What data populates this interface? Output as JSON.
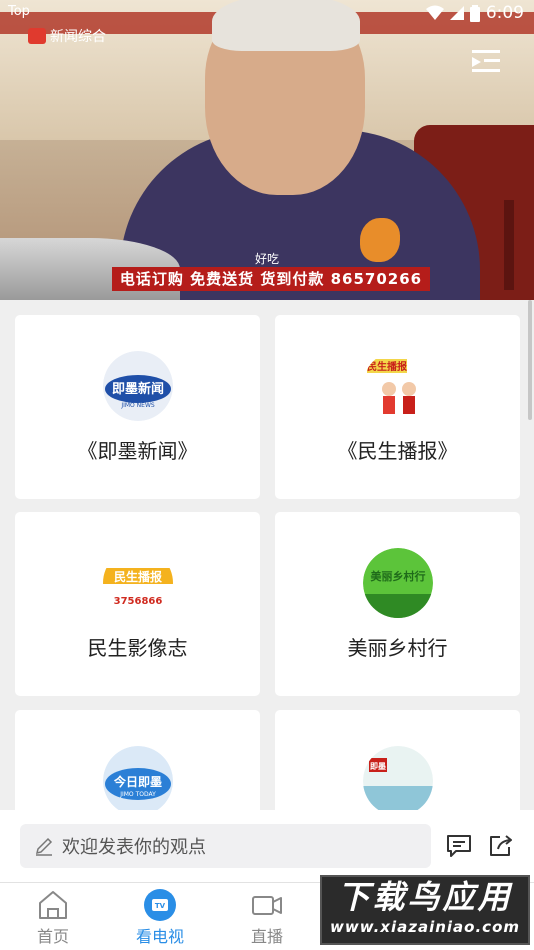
{
  "status_bar": {
    "left_text": "Top",
    "time": "6:09"
  },
  "video": {
    "channel": "新闻综合",
    "subtitle": "好吃",
    "banner": "电话订购 免费送货 货到付款 86570266"
  },
  "programs": [
    {
      "label": "《即墨新闻》",
      "avatar_text": "即墨新闻",
      "sub_text": "JIMO NEWS",
      "colors": [
        "#1f4fa8",
        "#e9eef6"
      ]
    },
    {
      "label": "《民生播报》",
      "avatar_text": "民生播报",
      "sub_text": "",
      "colors": [
        "#f3d64a",
        "#ffffff"
      ]
    },
    {
      "label": "民生影像志",
      "avatar_text": "民生播报",
      "sub_text": "3756866",
      "colors": [
        "#f4b21e",
        "#ffffff"
      ]
    },
    {
      "label": "美丽乡村行",
      "avatar_text": "美丽乡村行",
      "sub_text": "",
      "colors": [
        "#5cc43a",
        "#2f8a24"
      ]
    },
    {
      "label": "",
      "avatar_text": "今日即墨",
      "sub_text": "JIMO TODAY",
      "colors": [
        "#2b7fd6",
        "#dbe9f7"
      ]
    },
    {
      "label": "",
      "avatar_text": "即墨",
      "sub_text": "",
      "colors": [
        "#8fc6d8",
        "#e9f3f2"
      ]
    }
  ],
  "comment": {
    "placeholder": "欢迎发表你的观点"
  },
  "nav": [
    {
      "label": "首页",
      "icon": "home-icon",
      "active": false
    },
    {
      "label": "看电视",
      "icon": "tv-icon",
      "active": true
    },
    {
      "label": "直播",
      "icon": "video-camera-icon",
      "active": false
    }
  ],
  "watermark": {
    "line1": "下载鸟应用",
    "line2": "www.xiazainiao.com"
  },
  "accent_color": "#2a8ee6"
}
